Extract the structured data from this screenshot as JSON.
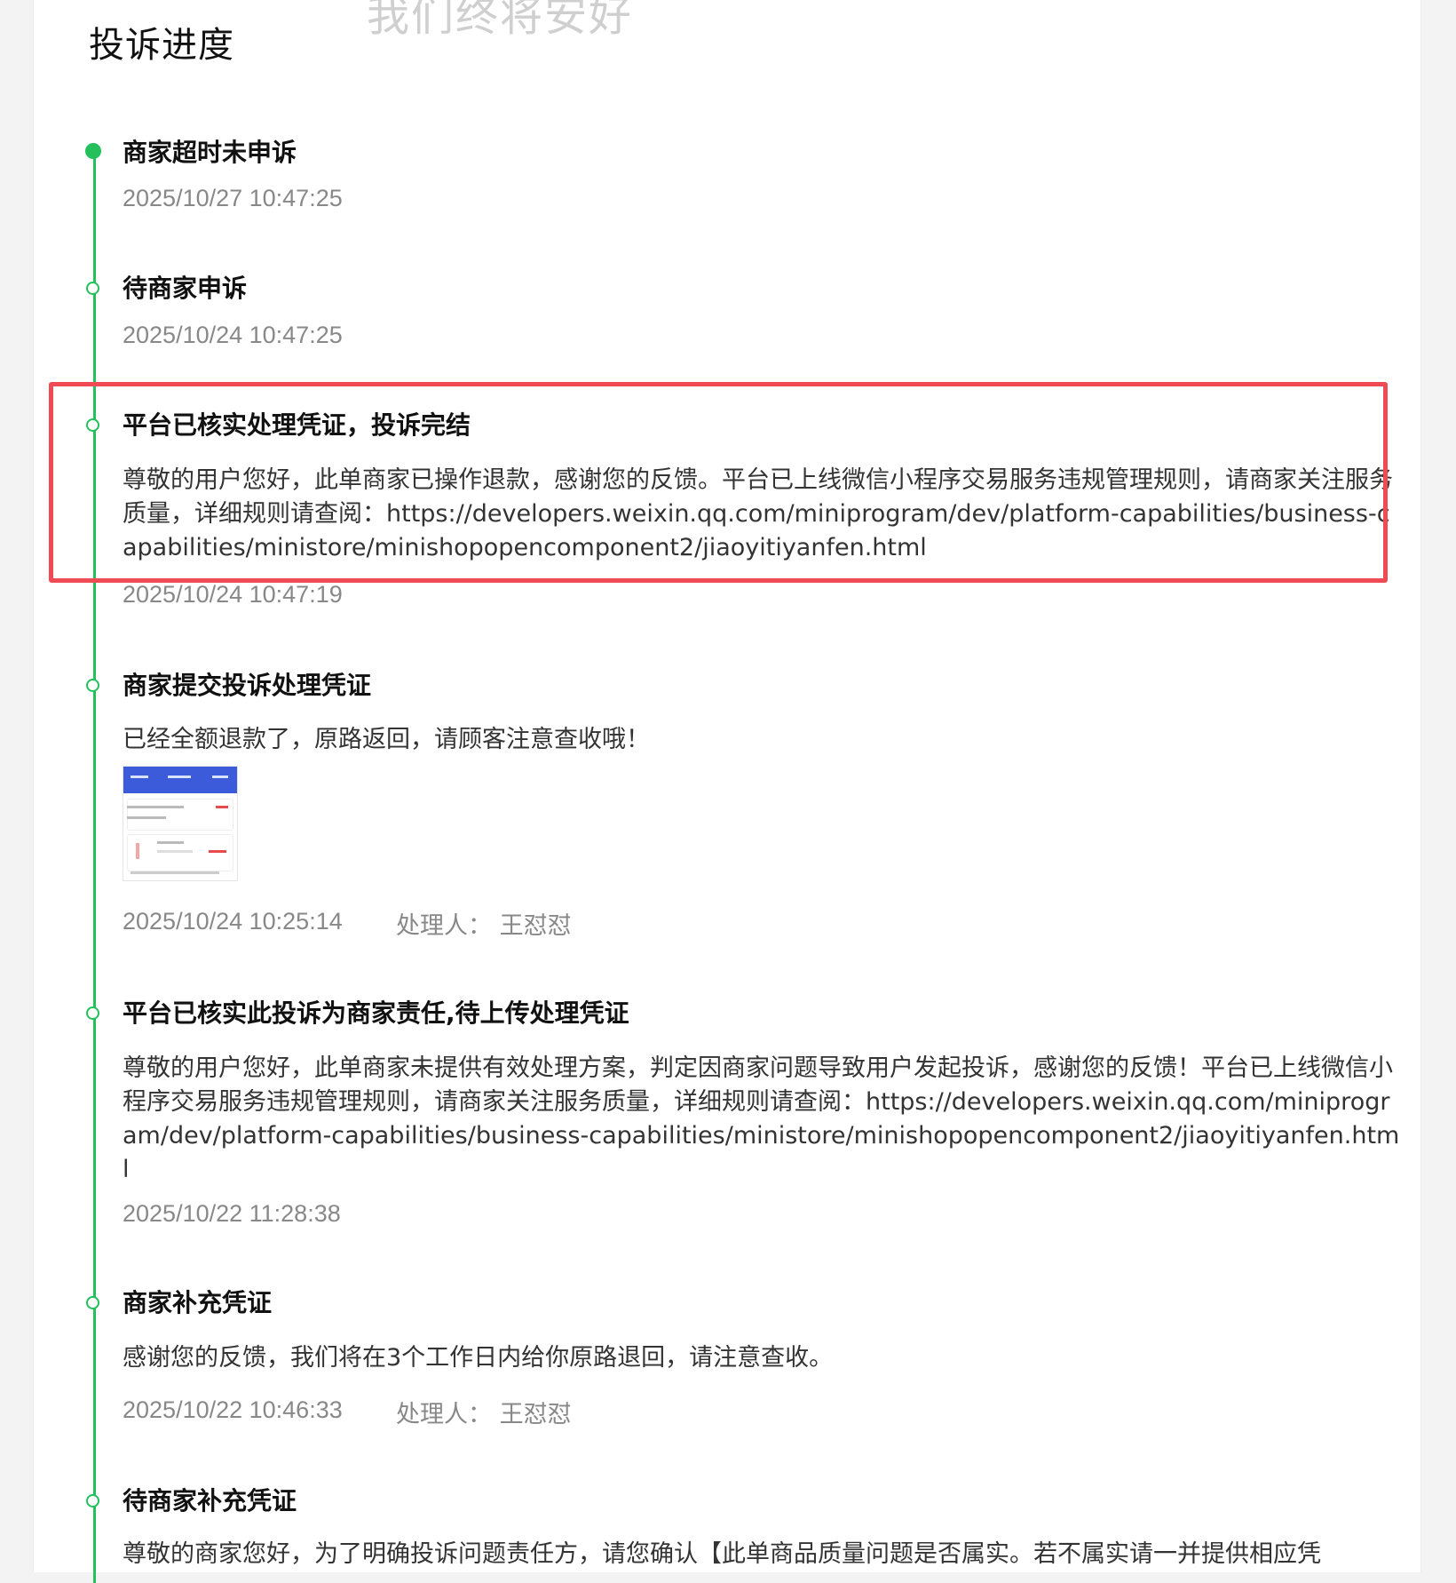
{
  "page": {
    "title": "投诉进度",
    "watermark": "我们终将安好"
  },
  "colors": {
    "accent": "#23c05c",
    "highlight": "#ee4b55"
  },
  "timeline": [
    {
      "title": "商家超时未申诉",
      "time": "2025/10/27 10:47:25"
    },
    {
      "title": "待商家申诉",
      "time": "2025/10/24 10:47:25"
    },
    {
      "title": "平台已核实处理凭证，投诉完结",
      "desc": "尊敬的用户您好，此单商家已操作退款，感谢您的反馈。平台已上线微信小程序交易服务违规管理规则，请商家关注服务质量，详细规则请查阅：https://developers.weixin.qq.com/miniprogram/dev/platform-capabilities/business-capabilities/ministore/minishopopencomponent2/jiaoyitiyanfen.html",
      "time": "2025/10/24 10:47:19"
    },
    {
      "title": "商家提交投诉处理凭证",
      "desc": "已经全额退款了，原路返回，请顾客注意查收哦！",
      "time": "2025/10/24 10:25:14",
      "handler": "处理人： 王怼怼"
    },
    {
      "title": "平台已核实此投诉为商家责任,待上传处理凭证",
      "desc": "尊敬的用户您好，此单商家未提供有效处理方案，判定因商家问题导致用户发起投诉，感谢您的反馈！平台已上线微信小程序交易服务违规管理规则，请商家关注服务质量，详细规则请查阅：https://developers.weixin.qq.com/miniprogram/dev/platform-capabilities/business-capabilities/ministore/minishopopencomponent2/jiaoyitiyanfen.html",
      "time": "2025/10/22 11:28:38"
    },
    {
      "title": "商家补充凭证",
      "desc": "感谢您的反馈，我们将在3个工作日内给你原路退回，请注意查收。",
      "time": "2025/10/22 10:46:33",
      "handler": "处理人： 王怼怼"
    },
    {
      "title": "待商家补充凭证",
      "desc": "尊敬的商家您好，为了明确投诉问题责任方，请您确认【此单商品质量问题是否属实。若不属实请一并提供相应凭"
    }
  ]
}
